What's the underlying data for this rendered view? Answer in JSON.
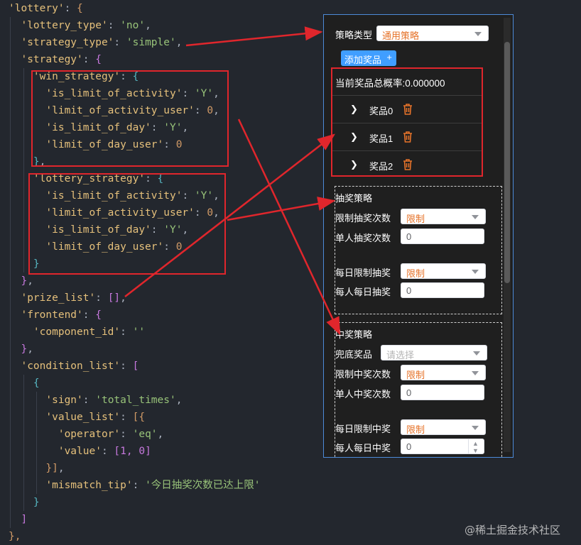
{
  "code": {
    "lines": [
      [
        [
          "'lottery'",
          "k"
        ],
        [
          ": ",
          "p"
        ],
        [
          "{",
          "b1"
        ]
      ],
      [
        [
          "  'lottery_type'",
          "k"
        ],
        [
          ": ",
          "p"
        ],
        [
          "'no'",
          "s"
        ],
        [
          ",",
          "p"
        ]
      ],
      [
        [
          "  'strategy_type'",
          "k"
        ],
        [
          ": ",
          "p"
        ],
        [
          "'simple'",
          "s"
        ],
        [
          ",",
          "p"
        ]
      ],
      [
        [
          "  'strategy'",
          "k"
        ],
        [
          ": ",
          "p"
        ],
        [
          "{",
          "b2"
        ]
      ],
      [
        [
          "    'win_strategy'",
          "k"
        ],
        [
          ": ",
          "p"
        ],
        [
          "{",
          "b3"
        ]
      ],
      [
        [
          "      'is_limit_of_activity'",
          "k"
        ],
        [
          ": ",
          "p"
        ],
        [
          "'Y'",
          "s"
        ],
        [
          ",",
          "p"
        ]
      ],
      [
        [
          "      'limit_of_activity_user'",
          "k"
        ],
        [
          ": ",
          "p"
        ],
        [
          "0",
          "n"
        ],
        [
          ",",
          "p"
        ]
      ],
      [
        [
          "      'is_limit_of_day'",
          "k"
        ],
        [
          ": ",
          "p"
        ],
        [
          "'Y'",
          "s"
        ],
        [
          ",",
          "p"
        ]
      ],
      [
        [
          "      'limit_of_day_user'",
          "k"
        ],
        [
          ": ",
          "p"
        ],
        [
          "0",
          "n"
        ]
      ],
      [
        [
          "    }",
          "b3"
        ],
        [
          ",",
          "p"
        ]
      ],
      [
        [
          "    'lottery_strategy'",
          "k"
        ],
        [
          ": ",
          "p"
        ],
        [
          "{",
          "b3"
        ]
      ],
      [
        [
          "      'is_limit_of_activity'",
          "k"
        ],
        [
          ": ",
          "p"
        ],
        [
          "'Y'",
          "s"
        ],
        [
          ",",
          "p"
        ]
      ],
      [
        [
          "      'limit_of_activity_user'",
          "k"
        ],
        [
          ": ",
          "p"
        ],
        [
          "0",
          "n"
        ],
        [
          ",",
          "p"
        ]
      ],
      [
        [
          "      'is_limit_of_day'",
          "k"
        ],
        [
          ": ",
          "p"
        ],
        [
          "'Y'",
          "s"
        ],
        [
          ",",
          "p"
        ]
      ],
      [
        [
          "      'limit_of_day_user'",
          "k"
        ],
        [
          ": ",
          "p"
        ],
        [
          "0",
          "n"
        ]
      ],
      [
        [
          "    }",
          "b3"
        ]
      ],
      [
        [
          "  }",
          "b2"
        ],
        [
          ",",
          "p"
        ]
      ],
      [
        [
          "  'prize_list'",
          "k"
        ],
        [
          ": ",
          "p"
        ],
        [
          "[]",
          "b2"
        ],
        [
          ",",
          "p"
        ]
      ],
      [
        [
          "  'frontend'",
          "k"
        ],
        [
          ": ",
          "p"
        ],
        [
          "{",
          "b2"
        ]
      ],
      [
        [
          "    'component_id'",
          "k"
        ],
        [
          ": ",
          "p"
        ],
        [
          "''",
          "s"
        ]
      ],
      [
        [
          "  }",
          "b2"
        ],
        [
          ",",
          "p"
        ]
      ],
      [
        [
          "  'condition_list'",
          "k"
        ],
        [
          ": ",
          "p"
        ],
        [
          "[",
          "b2"
        ]
      ],
      [
        [
          "    {",
          "b3"
        ]
      ],
      [
        [
          "      'sign'",
          "k"
        ],
        [
          ": ",
          "p"
        ],
        [
          "'total_times'",
          "s"
        ],
        [
          ",",
          "p"
        ]
      ],
      [
        [
          "      'value_list'",
          "k"
        ],
        [
          ": ",
          "p"
        ],
        [
          "[{",
          "b1"
        ]
      ],
      [
        [
          "        'operator'",
          "k"
        ],
        [
          ": ",
          "p"
        ],
        [
          "'eq'",
          "s"
        ],
        [
          ",",
          "p"
        ]
      ],
      [
        [
          "        'value'",
          "k"
        ],
        [
          ": ",
          "p"
        ],
        [
          "[1, 0]",
          "b2"
        ]
      ],
      [
        [
          "      }]",
          "b1"
        ],
        [
          ",",
          "p"
        ]
      ],
      [
        [
          "      'mismatch_tip'",
          "k"
        ],
        [
          ": ",
          "p"
        ],
        [
          "'今日抽奖次数已达上限'",
          "s"
        ]
      ],
      [
        [
          "    }",
          "b3"
        ]
      ],
      [
        [
          "  ]",
          "b2"
        ]
      ],
      [
        [
          "},",
          "b1"
        ]
      ]
    ]
  },
  "panel": {
    "strategy_type_label": "策略类型",
    "strategy_type_value": "通用策略",
    "add_prize_label": "添加奖品",
    "add_prize_icon": "plus-icon",
    "total_probability": "当前奖品总概率:0.000000",
    "prizes": [
      "奖品0",
      "奖品1",
      "奖品2"
    ],
    "lottery": {
      "title": "抽奖策略",
      "limit_label": "限制抽奖次数",
      "limit_value": "限制",
      "single_label": "单人抽奖次数",
      "single_value": "0",
      "daily_label": "每日限制抽奖",
      "daily_value": "限制",
      "daily_user_label": "每人每日抽奖",
      "daily_user_value": "0"
    },
    "win": {
      "title": "中奖策略",
      "fallback_label": "兜底奖品",
      "fallback_placeholder": "请选择",
      "limit_label": "限制中奖次数",
      "limit_value": "限制",
      "single_label": "单人中奖次数",
      "single_value": "0",
      "daily_label": "每日限制中奖",
      "daily_value": "限制",
      "daily_user_label": "每人每日中奖",
      "daily_user_value": "0"
    }
  },
  "watermark": "@稀土掘金技术社区",
  "colors": {
    "background": "#23272e",
    "annotation_red": "#e0262c",
    "accent_blue": "#409eff",
    "select_value_orange": "#e6732a",
    "trash_orange": "#e6732a"
  }
}
